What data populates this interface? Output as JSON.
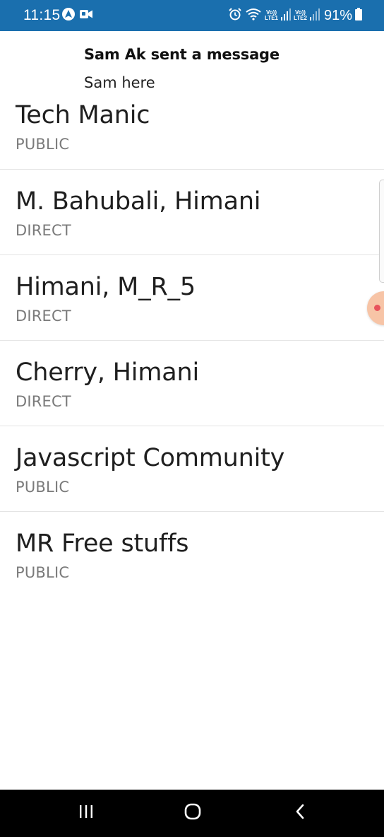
{
  "status_bar": {
    "time": "11:15",
    "battery": "91%",
    "icons": [
      "nav-arrow-icon",
      "video-icon",
      "alarm-icon",
      "wifi-icon",
      "volte-lte1-icon",
      "signal1-icon",
      "volte-lte2-icon",
      "signal2-icon",
      "battery-icon"
    ],
    "volte1_top": "Vo))",
    "volte1_bottom": "LTE1",
    "volte2_top": "Vo))",
    "volte2_bottom": "LTE2"
  },
  "notification": {
    "title": "Sam Ak sent a message",
    "body": "Sam here"
  },
  "channels": [
    {
      "name": "Tech Manic",
      "type": "PUBLIC"
    },
    {
      "name": "M. Bahubali, Himani",
      "type": "DIRECT"
    },
    {
      "name": "Himani, M_R_5",
      "type": "DIRECT"
    },
    {
      "name": "Cherry, Himani",
      "type": "DIRECT"
    },
    {
      "name": "Javascript Community",
      "type": "PUBLIC"
    },
    {
      "name": "MR Free stuffs",
      "type": "PUBLIC"
    }
  ],
  "nav_bar": {
    "buttons": [
      "recent-apps-icon",
      "home-icon",
      "back-icon"
    ]
  },
  "colors": {
    "status_bar": "#1a6fae",
    "divider": "#e4e4e4",
    "type_text": "#7a7a7a",
    "floating_button": "#f7c4a6",
    "floating_dot": "#e8525b"
  }
}
